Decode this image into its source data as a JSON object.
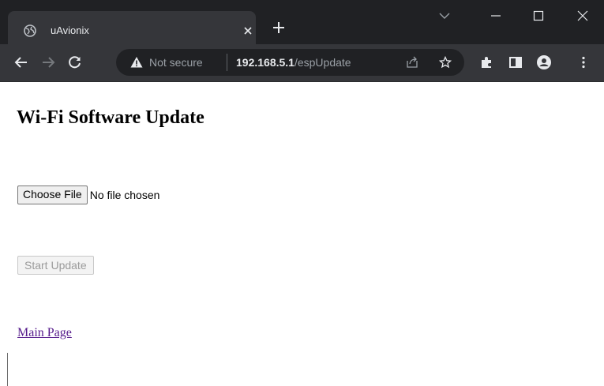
{
  "tab": {
    "title": "uAvionix",
    "favicon": "globe-icon"
  },
  "omnibox": {
    "security_label": "Not secure",
    "url_host": "192.168.5.1",
    "url_path": "/espUpdate"
  },
  "page": {
    "title": "Wi-Fi Software Update",
    "choose_file_label": "Choose File",
    "no_file_text": "No file chosen",
    "start_update_label": "Start Update",
    "main_page_link": "Main Page"
  },
  "colors": {
    "tabstrip_bg": "#202124",
    "toolbar_bg": "#35363a",
    "link_visited": "#551a8b"
  }
}
